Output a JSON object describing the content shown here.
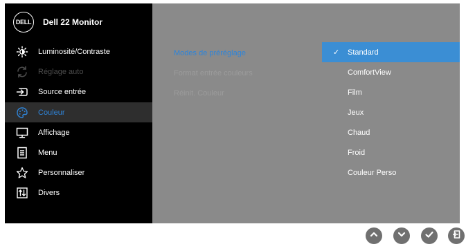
{
  "header": {
    "logo_text": "DELL",
    "model": "Dell 22 Monitor"
  },
  "menu": {
    "items": [
      {
        "label": "Luminosité/Contraste",
        "icon": "brightness-icon",
        "state": "normal"
      },
      {
        "label": "Réglage auto",
        "icon": "auto-adjust-icon",
        "state": "disabled"
      },
      {
        "label": "Source entrée",
        "icon": "input-source-icon",
        "state": "normal"
      },
      {
        "label": "Couleur",
        "icon": "color-icon",
        "state": "selected"
      },
      {
        "label": "Affichage",
        "icon": "display-icon",
        "state": "normal"
      },
      {
        "label": "Menu",
        "icon": "menu-icon",
        "state": "normal"
      },
      {
        "label": "Personnaliser",
        "icon": "star-icon",
        "state": "normal"
      },
      {
        "label": "Divers",
        "icon": "others-icon",
        "state": "normal"
      }
    ]
  },
  "submenu": {
    "items": [
      {
        "label": "Modes de préréglage",
        "state": "active"
      },
      {
        "label": "Format entrée couleurs",
        "state": "disabled"
      },
      {
        "label": "Réinit. Couleur",
        "state": "disabled"
      }
    ]
  },
  "options": {
    "check_mark": "✓",
    "items": [
      {
        "label": "Standard",
        "selected": true
      },
      {
        "label": "ComfortView",
        "selected": false
      },
      {
        "label": "Film",
        "selected": false
      },
      {
        "label": "Jeux",
        "selected": false
      },
      {
        "label": "Chaud",
        "selected": false
      },
      {
        "label": "Froid",
        "selected": false
      },
      {
        "label": "Couleur Perso",
        "selected": false
      }
    ]
  },
  "nav_buttons": [
    "up-icon",
    "down-icon",
    "check-icon",
    "back-icon"
  ],
  "colors": {
    "accent": "#2f84d8",
    "selected_bg": "#3b8ed4",
    "panel": "#8a8a8a",
    "menu_bg": "#000000"
  }
}
